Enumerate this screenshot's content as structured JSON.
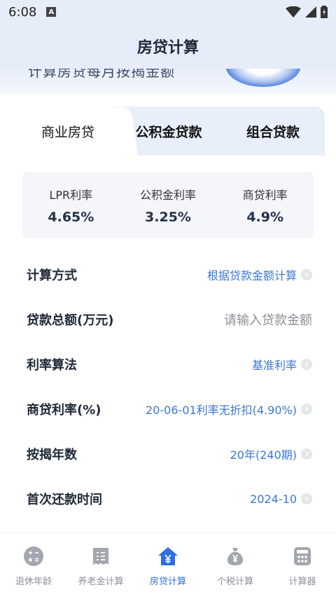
{
  "status_bar": {
    "time": "6:08",
    "notif": "A"
  },
  "header": {
    "title": "房贷计算"
  },
  "banner": {
    "text": "计算房贷每月按揭金额"
  },
  "tabs": [
    {
      "label": "商业房贷",
      "active": true
    },
    {
      "label": "公积金贷款",
      "active": false
    },
    {
      "label": "组合贷款",
      "active": false
    }
  ],
  "rates": [
    {
      "label": "LPR利率",
      "value": "4.65%"
    },
    {
      "label": "公积金利率",
      "value": "3.25%"
    },
    {
      "label": "商贷利率",
      "value": "4.9%"
    }
  ],
  "form": {
    "calc_method": {
      "label": "计算方式",
      "value": "根据贷款金额计算"
    },
    "loan_amount": {
      "label": "贷款总额(万元)",
      "placeholder": "请输入贷款金额"
    },
    "rate_method": {
      "label": "利率算法",
      "value": "基准利率"
    },
    "commercial_rate": {
      "label": "商贷利率(%)",
      "value": "20-06-01利率无折扣(4.90%)"
    },
    "years": {
      "label": "按揭年数",
      "value": "20年(240期)"
    },
    "first_payment": {
      "label": "首次还款时间",
      "value": "2024-10"
    }
  },
  "tabbar": [
    {
      "label": "退休年龄",
      "icon": "calculator-symbols-icon",
      "active": false
    },
    {
      "label": "养老金计算",
      "icon": "receipt-icon",
      "active": false
    },
    {
      "label": "房贷计算",
      "icon": "house-yen-icon",
      "active": true
    },
    {
      "label": "个税计算",
      "icon": "money-bag-icon",
      "active": false
    },
    {
      "label": "计算器",
      "icon": "calculator-icon",
      "active": false
    }
  ],
  "colors": {
    "accent": "#3a78d4",
    "header_bg": "#e6edf9",
    "active_tab_icon": "#2f6fe0"
  }
}
